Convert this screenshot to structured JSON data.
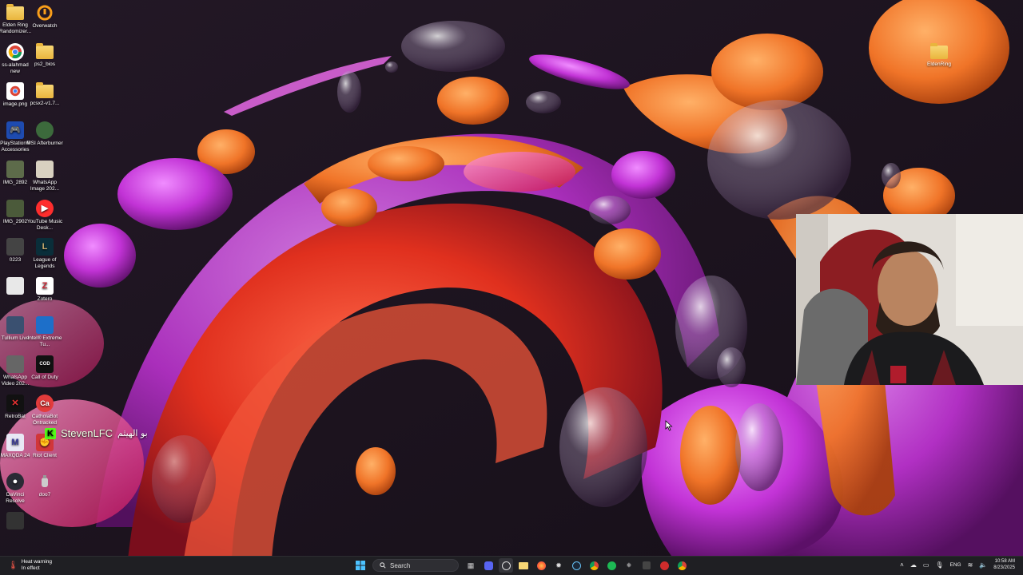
{
  "desktop": {
    "icons": [
      {
        "label": "Elden Ring Randomizer..."
      },
      {
        "label": "Overwatch"
      },
      {
        "label": "ss-alahmad new"
      },
      {
        "label": "ps2_bios"
      },
      {
        "label": "image.png"
      },
      {
        "label": "pcsx2-v1.7..."
      },
      {
        "label": "PlayStation® Accessories"
      },
      {
        "label": "MSI Afterburner"
      },
      {
        "label": "IMG_2892"
      },
      {
        "label": "WhatsApp Image 202..."
      },
      {
        "label": "IMG_2902"
      },
      {
        "label": "YouTube Music Desk..."
      },
      {
        "label": "0223"
      },
      {
        "label": "League of Legends"
      },
      {
        "label": "Zotero"
      },
      {
        "label": "Tullium Live"
      },
      {
        "label": "Intel® Extreme Tu..."
      },
      {
        "label": "WhatsApp Video 202..."
      },
      {
        "label": "Call of Duty"
      },
      {
        "label": "RetroBat"
      },
      {
        "label": "CatholaBot Ontracked"
      },
      {
        "label": "MAXQDA 24"
      },
      {
        "label": "Riot Client"
      },
      {
        "label": "DaVinci Resolve"
      },
      {
        "label": "doo7"
      },
      {
        "label": "EldenRing"
      }
    ]
  },
  "stream": {
    "username": "StevenLFC",
    "message": "بو الهيثم"
  },
  "taskbar": {
    "weather_line1": "Heat warning",
    "weather_line2": "In effect",
    "search_placeholder": "Search",
    "language": "ENG",
    "time": "10:58 AM",
    "date": "8/23/2025"
  },
  "icons": {
    "start": "windows-start-icon",
    "search": "search-icon",
    "weather": "thermometer-icon"
  },
  "colors": {
    "taskbar_bg": "#1f1f23",
    "kick_green": "#53fc18",
    "folder_yellow": "#f8d775"
  }
}
